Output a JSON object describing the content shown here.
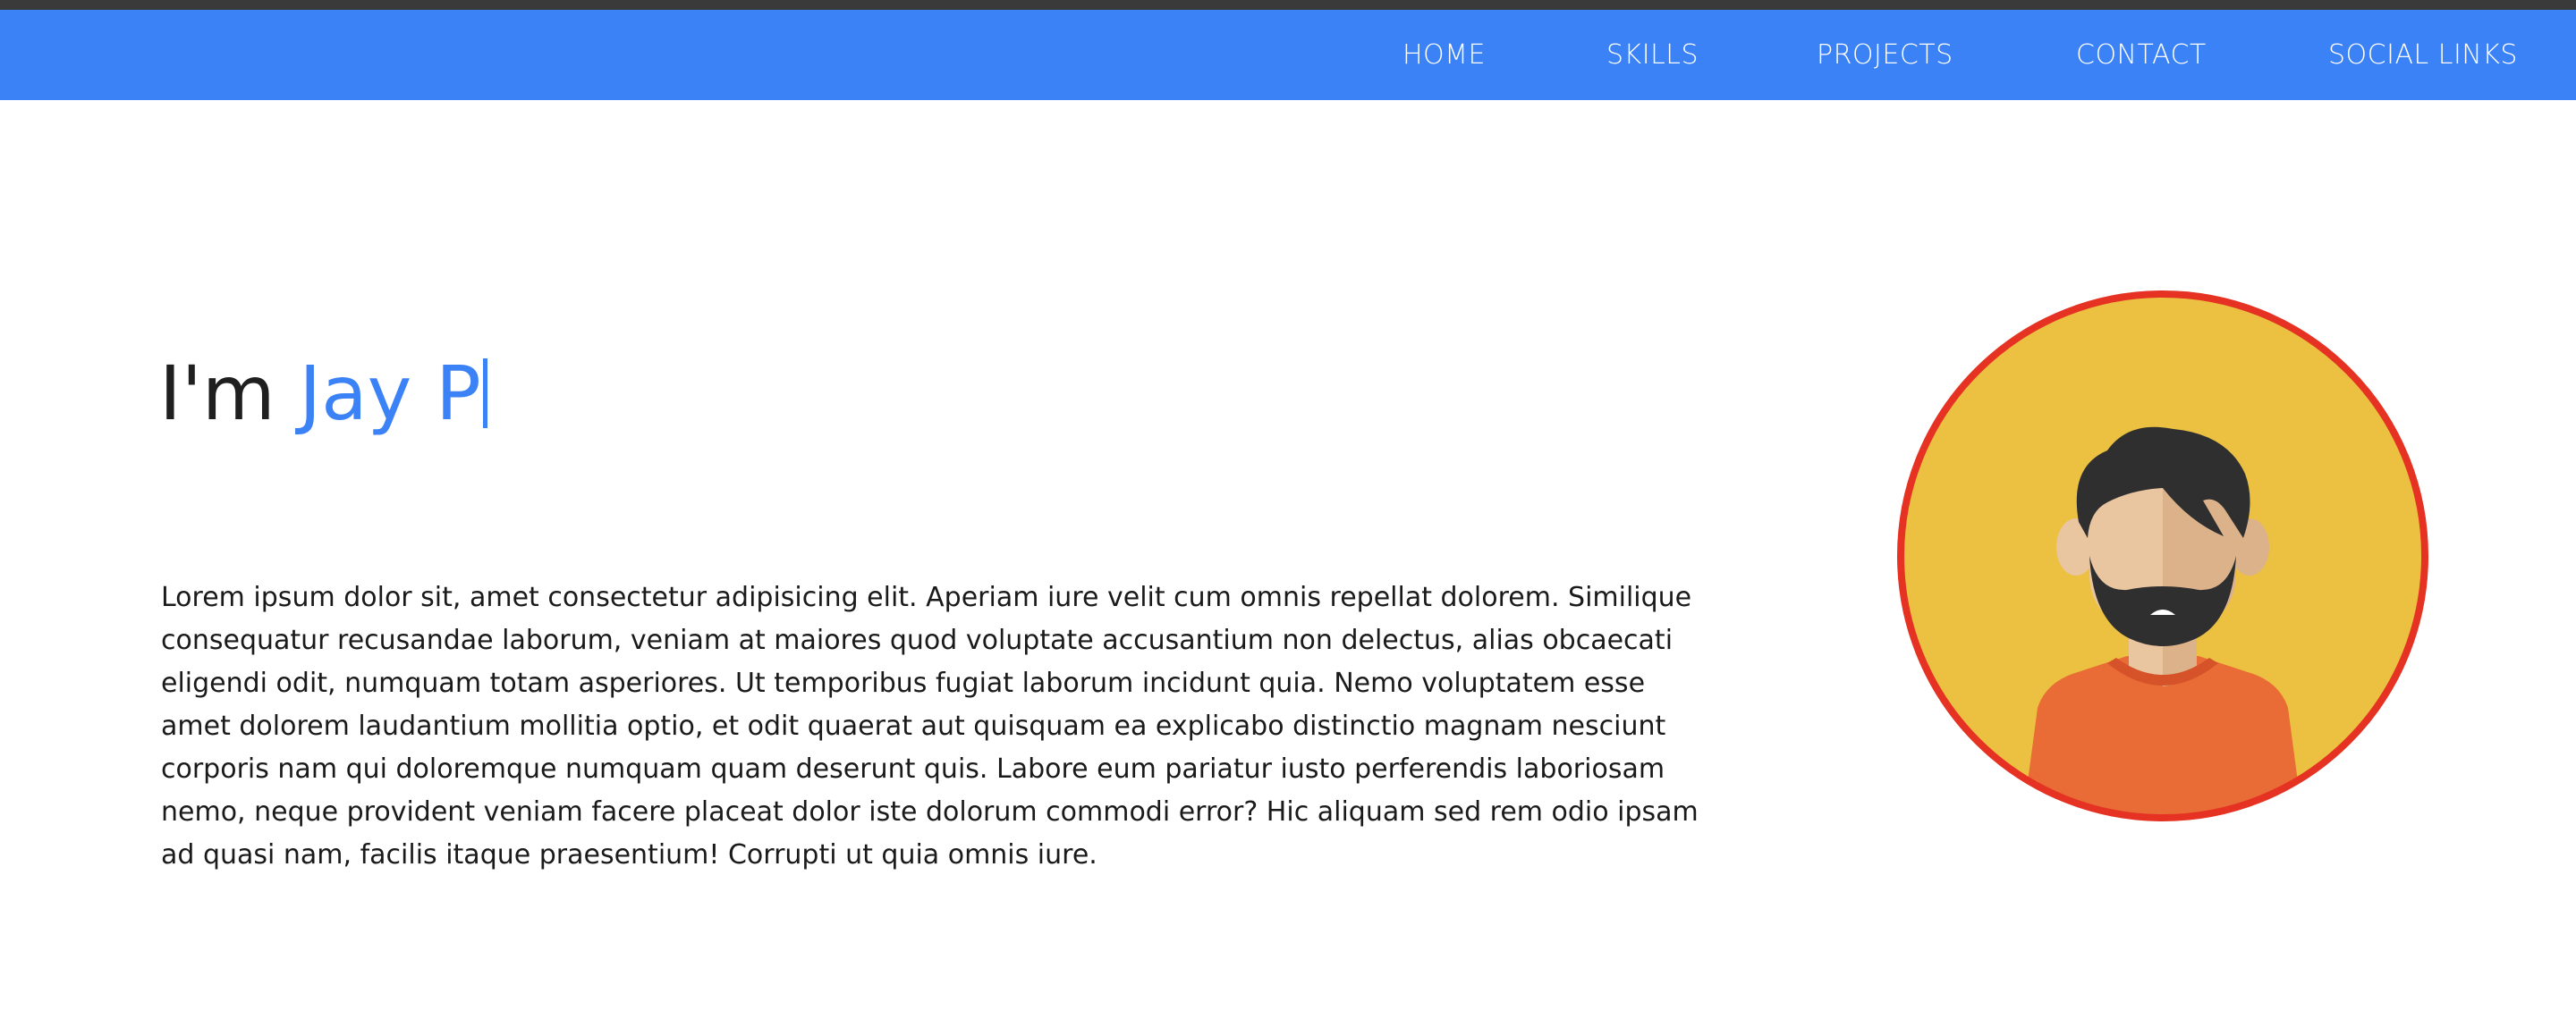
{
  "nav": {
    "items": [
      {
        "label": "HOME"
      },
      {
        "label": "SKILLS"
      },
      {
        "label": "PROJECTS"
      },
      {
        "label": "CONTACT"
      },
      {
        "label": "SOCIAL LINKS"
      }
    ]
  },
  "hero": {
    "prefix": "I'm",
    "name": "Jay P",
    "bio": "Lorem ipsum dolor sit, amet consectetur adipisicing elit. Aperiam iure velit cum omnis repellat dolorem. Similique consequatur recusandae laborum, veniam at maiores quod voluptate accusantium non delectus, alias obcaecati eligendi odit, numquam totam asperiores. Ut temporibus fugiat laborum incidunt quia. Nemo voluptatem esse amet dolorem laudantium mollitia optio, et odit quaerat aut quisquam ea explicabo distinctio magnam nesciunt corporis nam qui doloremque numquam quam deserunt quis. Labore eum pariatur iusto perferendis laboriosam nemo, neque provident veniam facere placeat dolor iste dolorum commodi error? Hic aliquam sed rem odio ipsam ad quasi nam, facilis itaque praesentium! Corrupti ut quia omnis iure."
  },
  "avatar": {
    "icon": "bearded-man-avatar-icon"
  },
  "colors": {
    "accent": "#3b82f6",
    "navbar": "#3b82f6",
    "top_strip": "#3a3a3a",
    "avatar_bg": "#ecc142",
    "avatar_border": "#e53222",
    "shirt": "#e96b35"
  }
}
